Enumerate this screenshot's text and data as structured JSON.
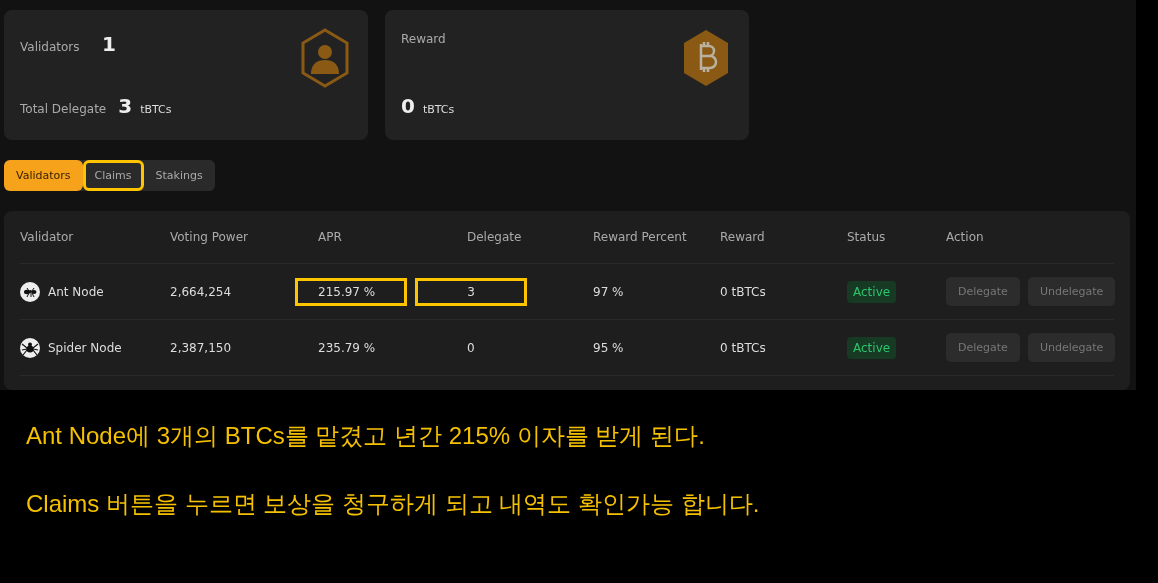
{
  "summary_cards": [
    {
      "kind": "validators",
      "rows": [
        {
          "label": "Validators",
          "value": "1"
        },
        {
          "label": "Total Delegate",
          "value": "3",
          "unit": "tBTCs"
        }
      ]
    },
    {
      "kind": "reward",
      "rows": [
        {
          "label": "Reward"
        },
        {
          "value": "0",
          "unit": "tBTCs"
        }
      ]
    }
  ],
  "tabs": [
    {
      "label": "Validators",
      "selected": true,
      "highlighted": false
    },
    {
      "label": "Claims",
      "selected": false,
      "highlighted": true
    },
    {
      "label": "Stakings",
      "selected": false,
      "highlighted": false
    }
  ],
  "table": {
    "columns": [
      "Validator",
      "Voting Power",
      "APR",
      "Delegate",
      "Reward Percent",
      "Reward",
      "Status",
      "Action"
    ],
    "rows": [
      {
        "kind": "ant",
        "validator": "Ant Node",
        "voting_power": "2,664,254",
        "apr": "215.97 %",
        "apr_highlighted": true,
        "delegate": "3",
        "delegate_highlighted": true,
        "reward_percent": "97 %",
        "reward": "0 tBTCs",
        "status": "Active",
        "actions": [
          "Delegate",
          "Undelegate"
        ]
      },
      {
        "kind": "spider",
        "validator": "Spider Node",
        "voting_power": "2,387,150",
        "apr": "235.79 %",
        "apr_highlighted": false,
        "delegate": "0",
        "delegate_highlighted": false,
        "reward_percent": "95 %",
        "reward": "0 tBTCs",
        "status": "Active",
        "actions": [
          "Delegate",
          "Undelegate"
        ]
      }
    ]
  },
  "notes": [
    "Ant Node에 3개의 BTCs를 맡겼고 년간 215% 이자를 받게 된다.",
    "Claims 버튼을 누르면 보상을 청구하게 되고 내역도 확인가능 합니다."
  ]
}
